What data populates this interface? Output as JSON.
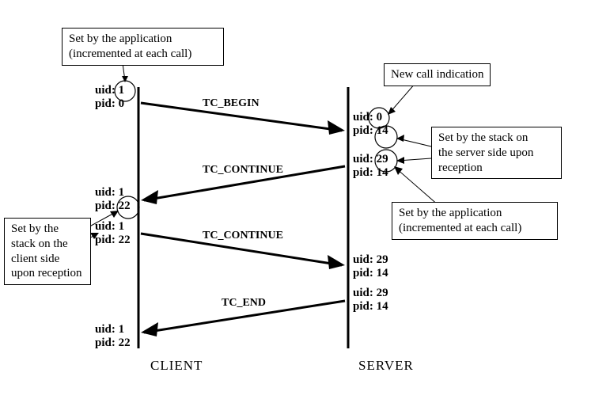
{
  "labels": {
    "uidKey": "uid:",
    "pidKey": "pid:"
  },
  "boxes": {
    "topLeft": "Set by the application\n(incremented at each call)",
    "newCall": "New call indication",
    "serverStack": "Set by the stack on\nthe server side upon\nreception",
    "serverApp": "Set by the application\n(incremented at each call)",
    "clientStack": "Set by the\nstack on the\nclient side\nupon reception"
  },
  "messages": {
    "m1": "TC_BEGIN",
    "m2": "TC_CONTINUE",
    "m3": "TC_CONTINUE",
    "m4": "TC_END"
  },
  "roles": {
    "client": "CLIENT",
    "server": "SERVER"
  },
  "values": {
    "c1_uid": "1",
    "c1_pid": "0",
    "s1_uid": "0",
    "s1_pid": "14",
    "s2_uid": "29",
    "s2_pid": "14",
    "c2_uid": "1",
    "c2_pid": "22",
    "c3_uid": "1",
    "c3_pid": "22",
    "s3_uid": "29",
    "s3_pid": "14",
    "s4_uid": "29",
    "s4_pid": "14",
    "c4_uid": "1",
    "c4_pid": "22"
  }
}
